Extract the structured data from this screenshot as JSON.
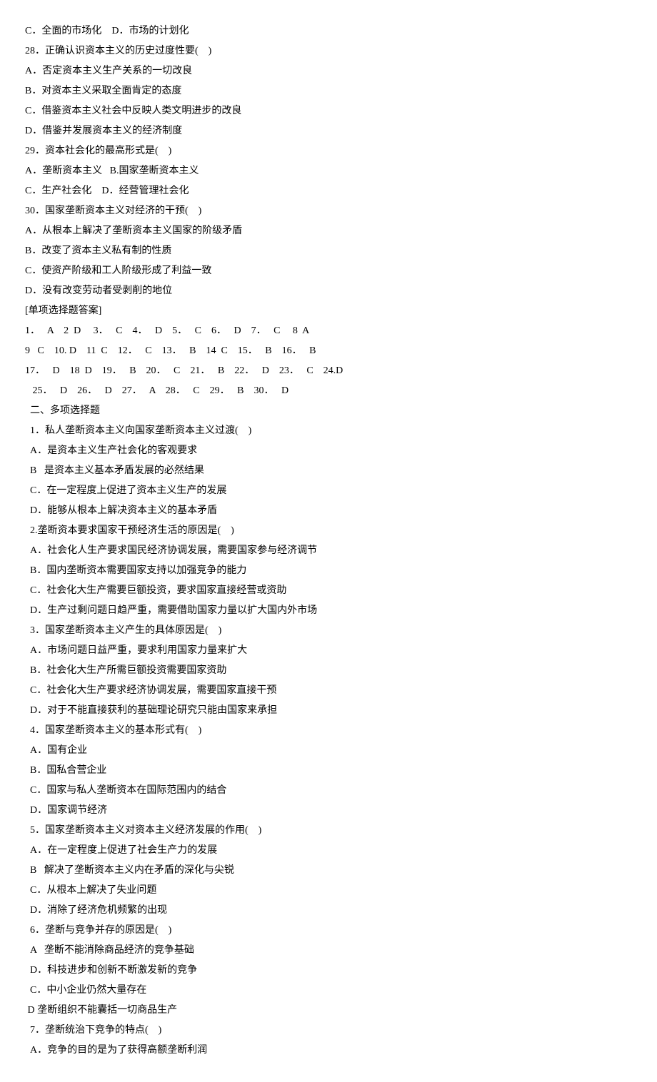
{
  "lines": [
    "C．全面的市场化    D．市场的计划化",
    "28．正确认识资本主义的历史过度性要(    )",
    "A．否定资本主义生产关系的一切改良",
    "B．对资本主义采取全面肯定的态度",
    "C．借鉴资本主义社会中反映人类文明进步的改良",
    "D．借鉴并发展资本主义的经济制度",
    "29．资本社会化的最高形式是(    )",
    "A．垄断资本主义   B.国家垄断资本主义",
    "C．生产社会化    D．经营管理社会化",
    "30．国家垄断资本主义对经济的干预(    )",
    "A．从根本上解决了垄断资本主义国家的阶级矛盾",
    "B．改变了资本主义私有制的性质",
    "C．使资产阶级和工人阶级形成了利益一致",
    "D．没有改变劳动者受剥削的地位",
    "[单项选择题答案]",
    "1．   A    2  D     3．   C    4．   D    5．   C    6．   D    7．   C     8  A",
    "9   C    10. D    11  C    12．   C    13．   B    14  C    15．   B    16．   B",
    "17．   D    18  D    19．   B    20．   C    21．   B    22．   D    23．   C    24.D",
    "   25．   D    26．   D    27．   A    28．   C    29．   B    30．   D",
    "  二、多项选择题",
    "  1．私人垄断资本主义向国家垄断资本主义过渡(    )",
    "  A．是资本主义生产社会化的客观要求",
    "  B   是资本主义基本矛盾发展的必然结果",
    "  C．在一定程度上促进了资本主义生产的发展",
    "  D．能够从根本上解决资本主义的基本矛盾",
    "  2.垄断资本要求国家干预经济生活的原因是(    )",
    "  A．社会化人生产要求国民经济协调发展，需要国家参与经济调节",
    "  B．国内垄断资本需要国家支持以加强竞争的能力",
    "  C．社会化大生产需要巨额投资，要求国家直接经营或资助",
    "  D．生产过剩问题日趋严重，需要借助国家力量以扩大国内外市场",
    "  3．国家垄断资本主义产生的具体原因是(    )",
    "  A．市场问题日益严重，要求利用国家力量来扩大",
    "  B．社会化大生产所需巨额投资需要国家资助",
    "  C．社会化大生产要求经济协调发展，需要国家直接干预",
    "  D．对于不能直接获利的基础理论研究只能由国家来承担",
    "  4．国家垄断资本主义的基本形式有(    )",
    "  A．国有企业",
    "  B．国私合营企业",
    "  C．国家与私人垄断资本在国际范围内的结合",
    "  D．国家调节经济",
    "  5．国家垄断资本主义对资本主义经济发展的作用(    )",
    "  A．在一定程度上促进了社会生产力的发展",
    "  B   解决了垄断资本主义内在矛盾的深化与尖锐",
    "  C．从根本上解决了失业问题",
    "  D．消除了经济危机频繁的出现",
    "  6．垄断与竞争并存的原因是(    )",
    "  A   垄断不能消除商品经济的竞争基础",
    "  D．科技进步和创新不断激发新的竞争",
    "  C．中小企业仍然大量存在",
    " D 垄断组织不能囊括一切商品生产",
    "  7．垄断统治下竞争的特点(    )",
    "  A．竞争的目的是为了获得高额垄断利润"
  ]
}
